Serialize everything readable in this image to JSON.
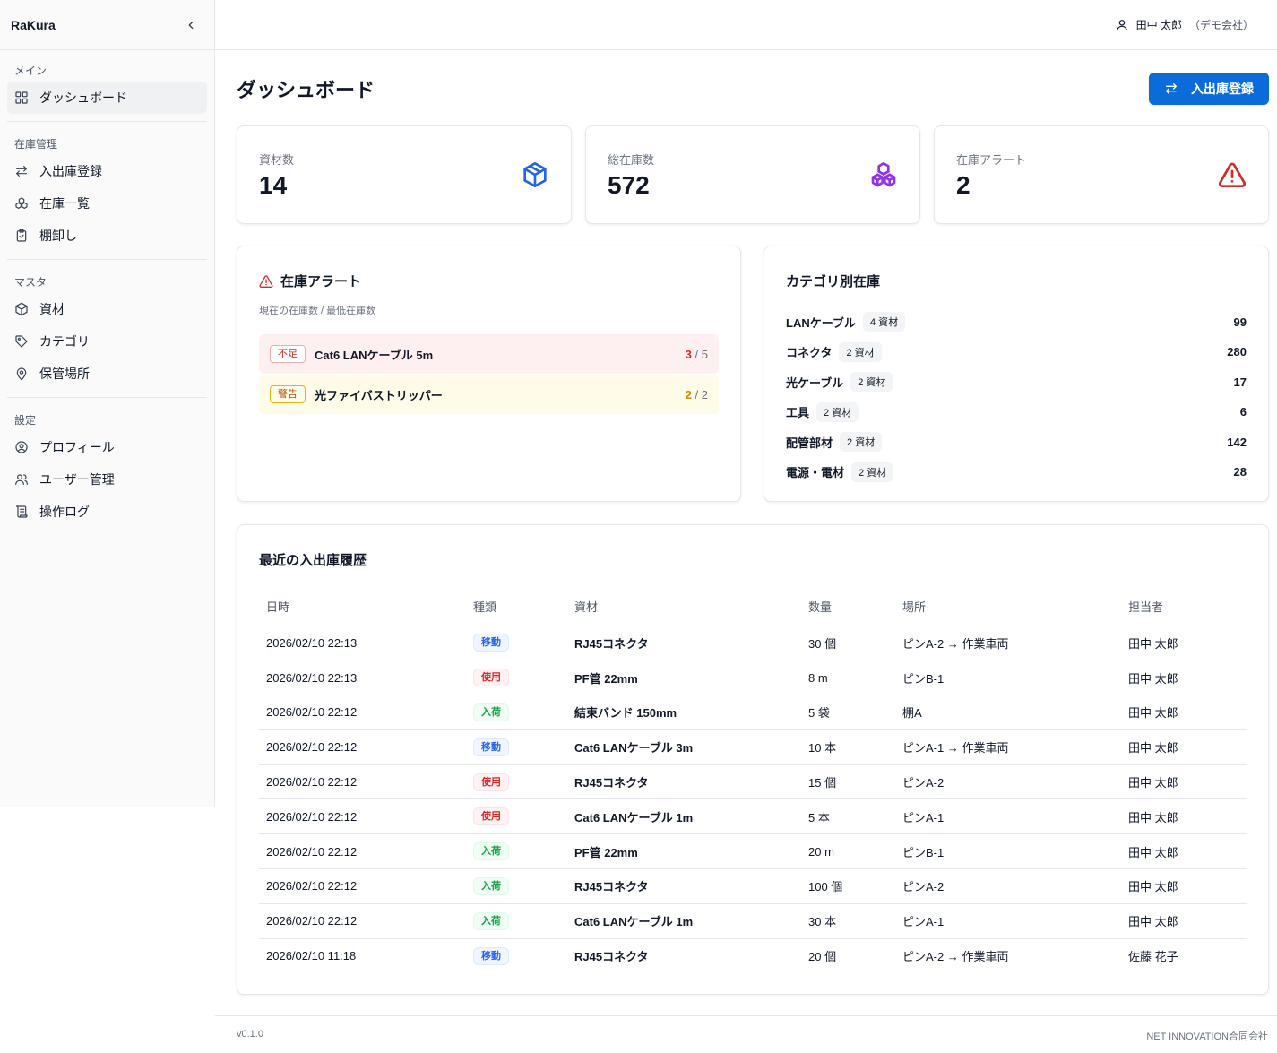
{
  "app": {
    "name": "RaKura"
  },
  "user": {
    "name": "田中 太郎",
    "org": "（デモ会社）"
  },
  "sidebar": {
    "groups": [
      {
        "label": "メイン",
        "items": [
          {
            "label": "ダッシュボード",
            "icon": "dashboard-icon",
            "active": true
          }
        ]
      },
      {
        "label": "在庫管理",
        "items": [
          {
            "label": "入出庫登録",
            "icon": "arrows-swap-icon"
          },
          {
            "label": "在庫一覧",
            "icon": "boxes-icon"
          },
          {
            "label": "棚卸し",
            "icon": "clipboard-check-icon"
          }
        ]
      },
      {
        "label": "マスタ",
        "items": [
          {
            "label": "資材",
            "icon": "package-icon"
          },
          {
            "label": "カテゴリ",
            "icon": "tag-icon"
          },
          {
            "label": "保管場所",
            "icon": "map-pin-icon"
          }
        ]
      },
      {
        "label": "設定",
        "items": [
          {
            "label": "プロフィール",
            "icon": "user-circle-icon"
          },
          {
            "label": "ユーザー管理",
            "icon": "users-icon"
          },
          {
            "label": "操作ログ",
            "icon": "scroll-icon"
          }
        ]
      }
    ]
  },
  "page": {
    "title": "ダッシュボード",
    "primary_action": "入出庫登録"
  },
  "stats": [
    {
      "label": "資材数",
      "value": "14",
      "icon": "package-icon",
      "color": "#2563eb"
    },
    {
      "label": "総在庫数",
      "value": "572",
      "icon": "boxes-icon",
      "color": "#9333ea"
    },
    {
      "label": "在庫アラート",
      "value": "2",
      "icon": "alert-triangle-icon",
      "color": "#dc2626"
    }
  ],
  "alerts": {
    "title": "在庫アラート",
    "subtitle": "現在の在庫数 / 最低在庫数",
    "items": [
      {
        "tag": "不足",
        "name": "Cat6 LANケーブル 5m",
        "current": "3",
        "min": "/ 5",
        "level": "red"
      },
      {
        "tag": "警告",
        "name": "光ファイバストリッパー",
        "current": "2",
        "min": "/ 2",
        "level": "yellow"
      }
    ]
  },
  "categories": {
    "title": "カテゴリ別在庫",
    "items": [
      {
        "name": "LANケーブル",
        "badge": "4 資材",
        "value": "99"
      },
      {
        "name": "コネクタ",
        "badge": "2 資材",
        "value": "280"
      },
      {
        "name": "光ケーブル",
        "badge": "2 資材",
        "value": "17"
      },
      {
        "name": "工具",
        "badge": "2 資材",
        "value": "6"
      },
      {
        "name": "配管部材",
        "badge": "2 資材",
        "value": "142"
      },
      {
        "name": "電源・電材",
        "badge": "2 資材",
        "value": "28"
      }
    ]
  },
  "history": {
    "title": "最近の入出庫履歴",
    "columns": [
      "日時",
      "種類",
      "資材",
      "数量",
      "場所",
      "担当者"
    ],
    "rows": [
      {
        "datetime": "2026/02/10 22:13",
        "type": "移動",
        "kind": "move",
        "material": "RJ45コネクタ",
        "qty": "30 個",
        "location": "ピンA-2 → 作業車両",
        "staff": "田中 太郎"
      },
      {
        "datetime": "2026/02/10 22:13",
        "type": "使用",
        "kind": "use",
        "material": "PF管 22mm",
        "qty": "8 m",
        "location": "ピンB-1",
        "staff": "田中 太郎"
      },
      {
        "datetime": "2026/02/10 22:12",
        "type": "入荷",
        "kind": "in",
        "material": "結束バンド 150mm",
        "qty": "5 袋",
        "location": "棚A",
        "staff": "田中 太郎"
      },
      {
        "datetime": "2026/02/10 22:12",
        "type": "移動",
        "kind": "move",
        "material": "Cat6 LANケーブル 3m",
        "qty": "10 本",
        "location": "ピンA-1 → 作業車両",
        "staff": "田中 太郎"
      },
      {
        "datetime": "2026/02/10 22:12",
        "type": "使用",
        "kind": "use",
        "material": "RJ45コネクタ",
        "qty": "15 個",
        "location": "ピンA-2",
        "staff": "田中 太郎"
      },
      {
        "datetime": "2026/02/10 22:12",
        "type": "使用",
        "kind": "use",
        "material": "Cat6 LANケーブル 1m",
        "qty": "5 本",
        "location": "ピンA-1",
        "staff": "田中 太郎"
      },
      {
        "datetime": "2026/02/10 22:12",
        "type": "入荷",
        "kind": "in",
        "material": "PF管 22mm",
        "qty": "20 m",
        "location": "ピンB-1",
        "staff": "田中 太郎"
      },
      {
        "datetime": "2026/02/10 22:12",
        "type": "入荷",
        "kind": "in",
        "material": "RJ45コネクタ",
        "qty": "100 個",
        "location": "ピンA-2",
        "staff": "田中 太郎"
      },
      {
        "datetime": "2026/02/10 22:12",
        "type": "入荷",
        "kind": "in",
        "material": "Cat6 LANケーブル 1m",
        "qty": "30 本",
        "location": "ピンA-1",
        "staff": "田中 太郎"
      },
      {
        "datetime": "2026/02/10 11:18",
        "type": "移動",
        "kind": "move",
        "material": "RJ45コネクタ",
        "qty": "20 個",
        "location": "ピンA-2 → 作業車両",
        "staff": "佐藤 花子"
      }
    ]
  },
  "footer": {
    "version": "v0.1.0",
    "company": "NET INNOVATION合同会社"
  }
}
